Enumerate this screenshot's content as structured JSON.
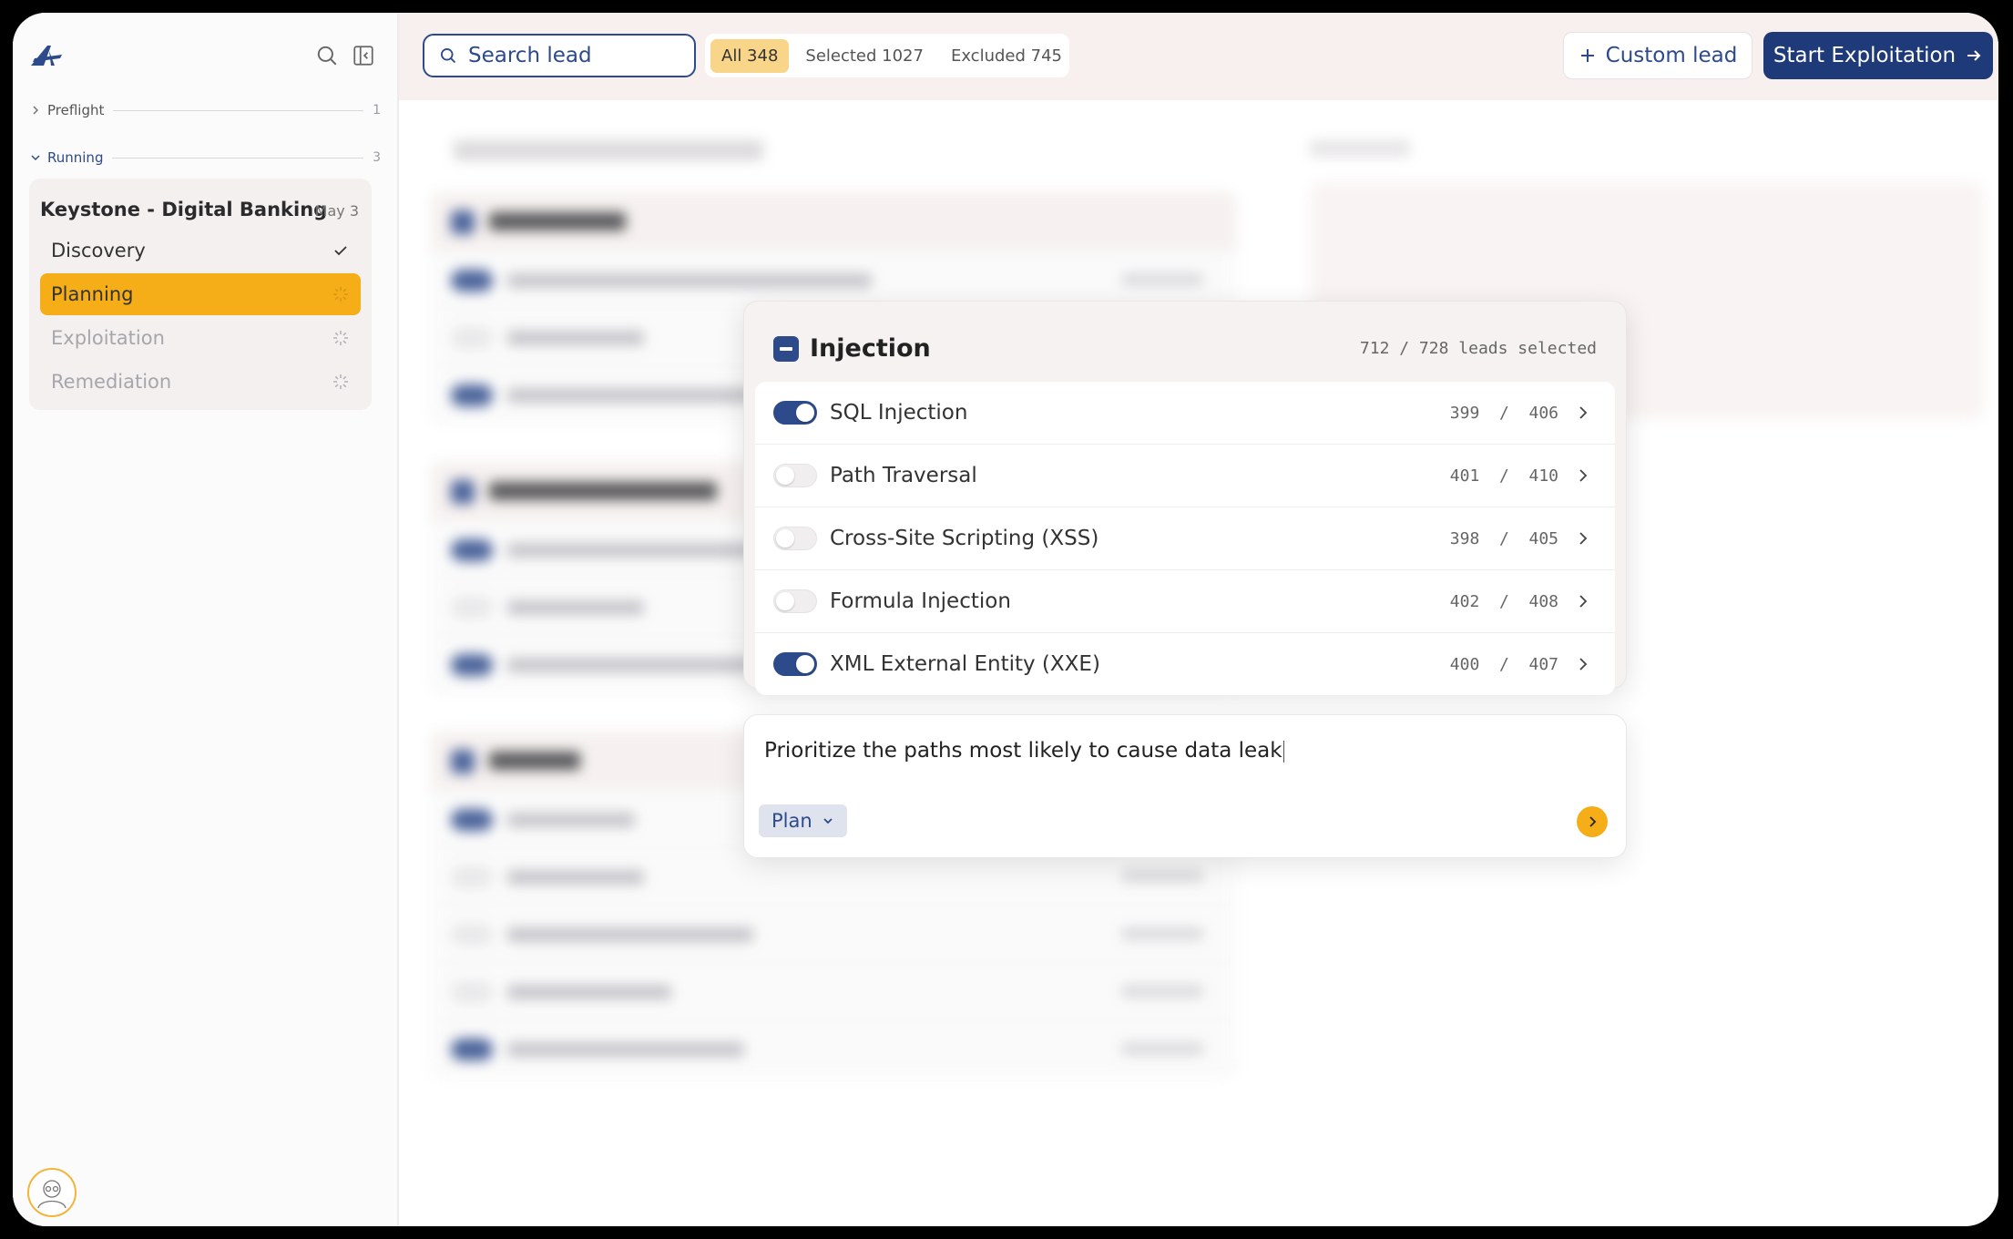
{
  "sidebar": {
    "sections": [
      {
        "label": "Preflight",
        "count": "1"
      },
      {
        "label": "Running",
        "count": "3"
      }
    ],
    "run": {
      "title": "Keystone - Digital Banking",
      "date": "May 3",
      "steps": [
        {
          "label": "Discovery",
          "state": "done"
        },
        {
          "label": "Planning",
          "state": "active"
        },
        {
          "label": "Exploitation",
          "state": "pending"
        },
        {
          "label": "Remediation",
          "state": "pending"
        }
      ]
    }
  },
  "topbar": {
    "search_placeholder": "Search lead",
    "filters": [
      {
        "label": "All 348",
        "active": true
      },
      {
        "label": "Selected 1027",
        "active": false
      },
      {
        "label": "Excluded 745",
        "active": false
      }
    ],
    "custom_lead_label": "Custom lead",
    "start_label": "Start Exploitation"
  },
  "popover": {
    "title": "Injection",
    "summary": "712 / 728 leads selected",
    "leads": [
      {
        "name": "SQL Injection",
        "count": "399  /  406",
        "enabled": true
      },
      {
        "name": "Path Traversal",
        "count": "401  /  410",
        "enabled": false
      },
      {
        "name": "Cross-Site Scripting (XSS)",
        "count": "398  /  405",
        "enabled": false
      },
      {
        "name": "Formula Injection",
        "count": "402  /  408",
        "enabled": false
      },
      {
        "name": "XML External Entity (XXE)",
        "count": "400  /  407",
        "enabled": true
      }
    ]
  },
  "prompt": {
    "text": "Prioritize the paths most likely to cause data leak",
    "mode_label": "Plan"
  },
  "colors": {
    "brand_navy": "#1f3a78",
    "accent_amber": "#f5ad18"
  }
}
